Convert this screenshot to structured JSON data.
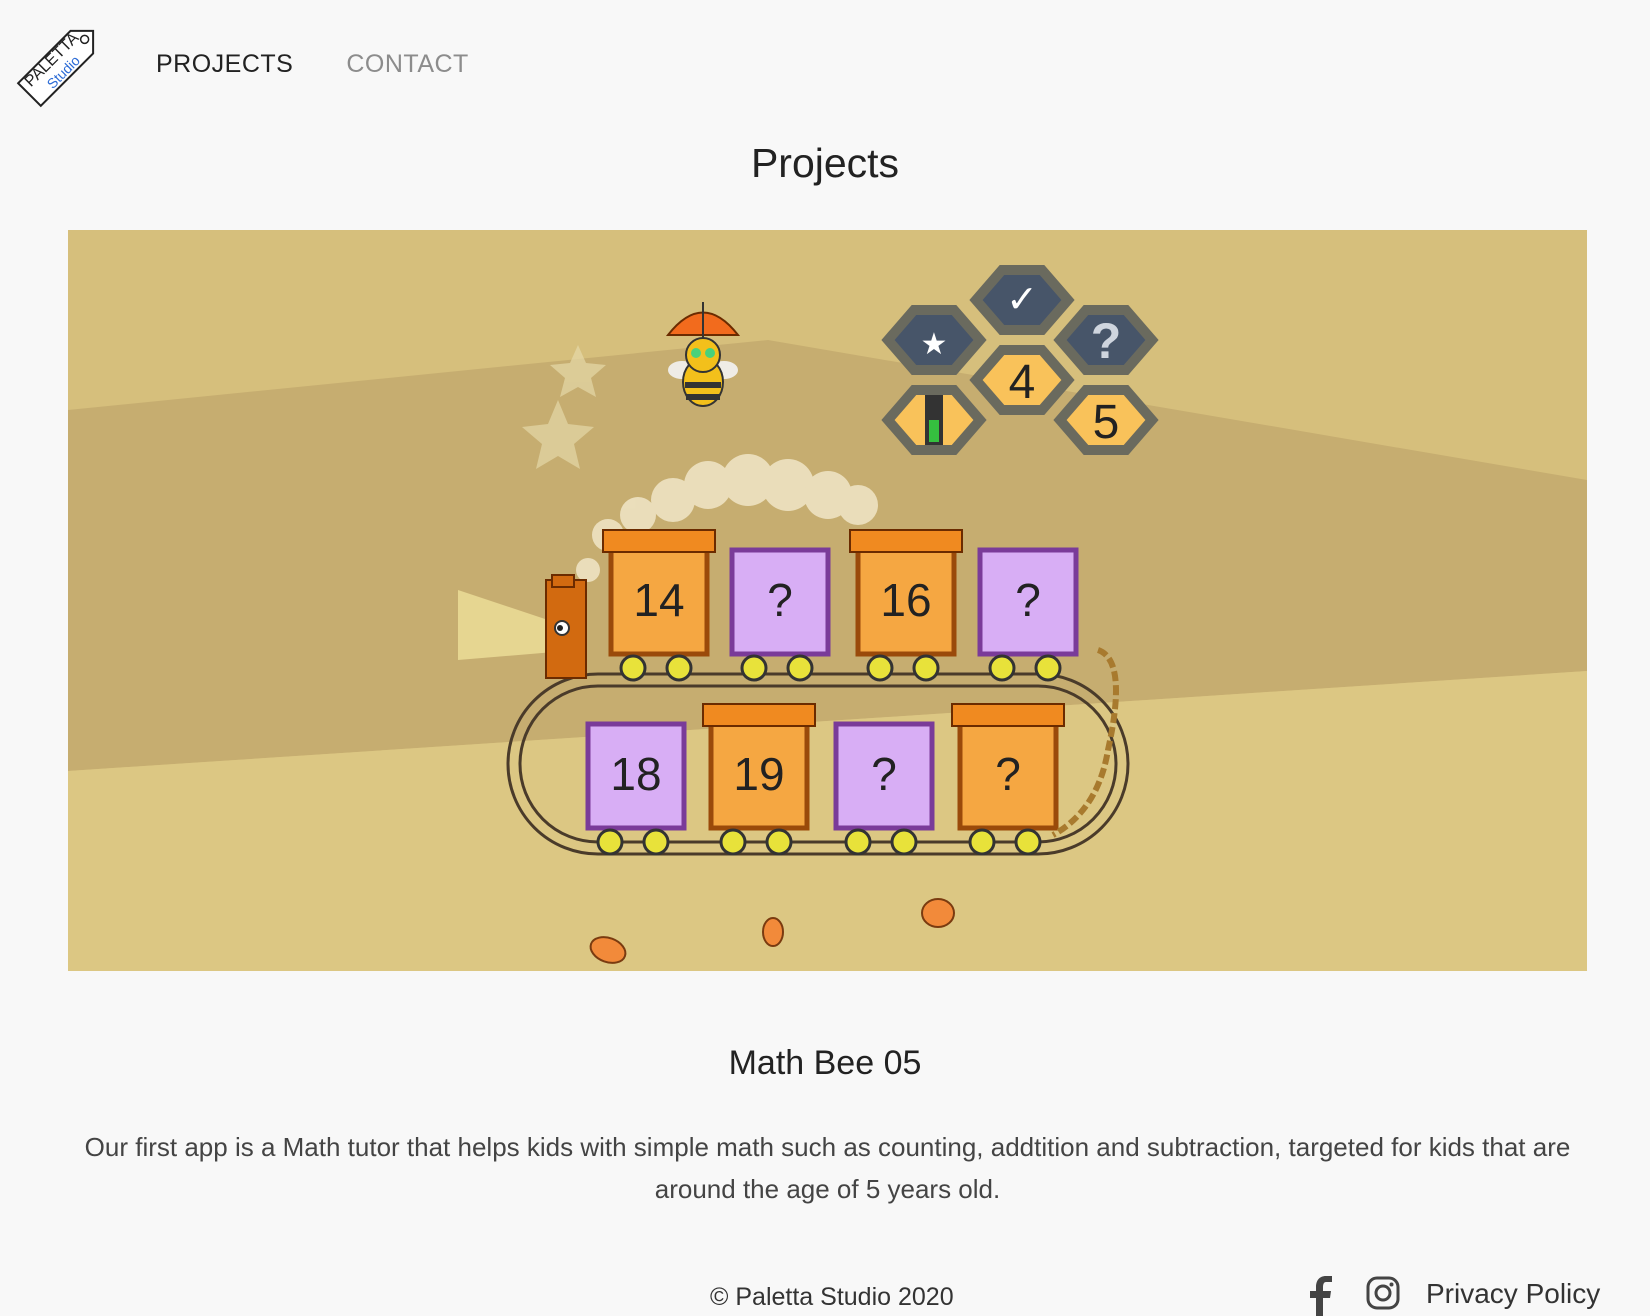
{
  "logo": {
    "line1": "PALETTA",
    "line2": "Studio"
  },
  "nav": {
    "projects": "PROJECTS",
    "contact": "CONTACT"
  },
  "page_title": "Projects",
  "hero": {
    "wagons_top": [
      "14",
      "?",
      "16",
      "?"
    ],
    "wagons_bottom": [
      "18",
      "19",
      "?",
      "?"
    ],
    "hex_values": [
      "4",
      "5",
      "?"
    ]
  },
  "project": {
    "title": "Math Bee 05",
    "description": "Our first app is a Math tutor that helps kids with simple math such as counting, addtition and subtraction, targeted for kids that are around the age of 5 years old."
  },
  "footer": {
    "copyright": "© Paletta Studio 2020",
    "privacy": "Privacy Policy",
    "icons": [
      "facebook-icon",
      "instagram-icon"
    ]
  },
  "colors": {
    "background": "#f8f8f8",
    "hero_bg": "#d8c27c",
    "wagon_orange": "#f5a742",
    "wagon_purple": "#d8aef5",
    "hex_dark": "#475569",
    "hex_yellow": "#f9c25a"
  }
}
